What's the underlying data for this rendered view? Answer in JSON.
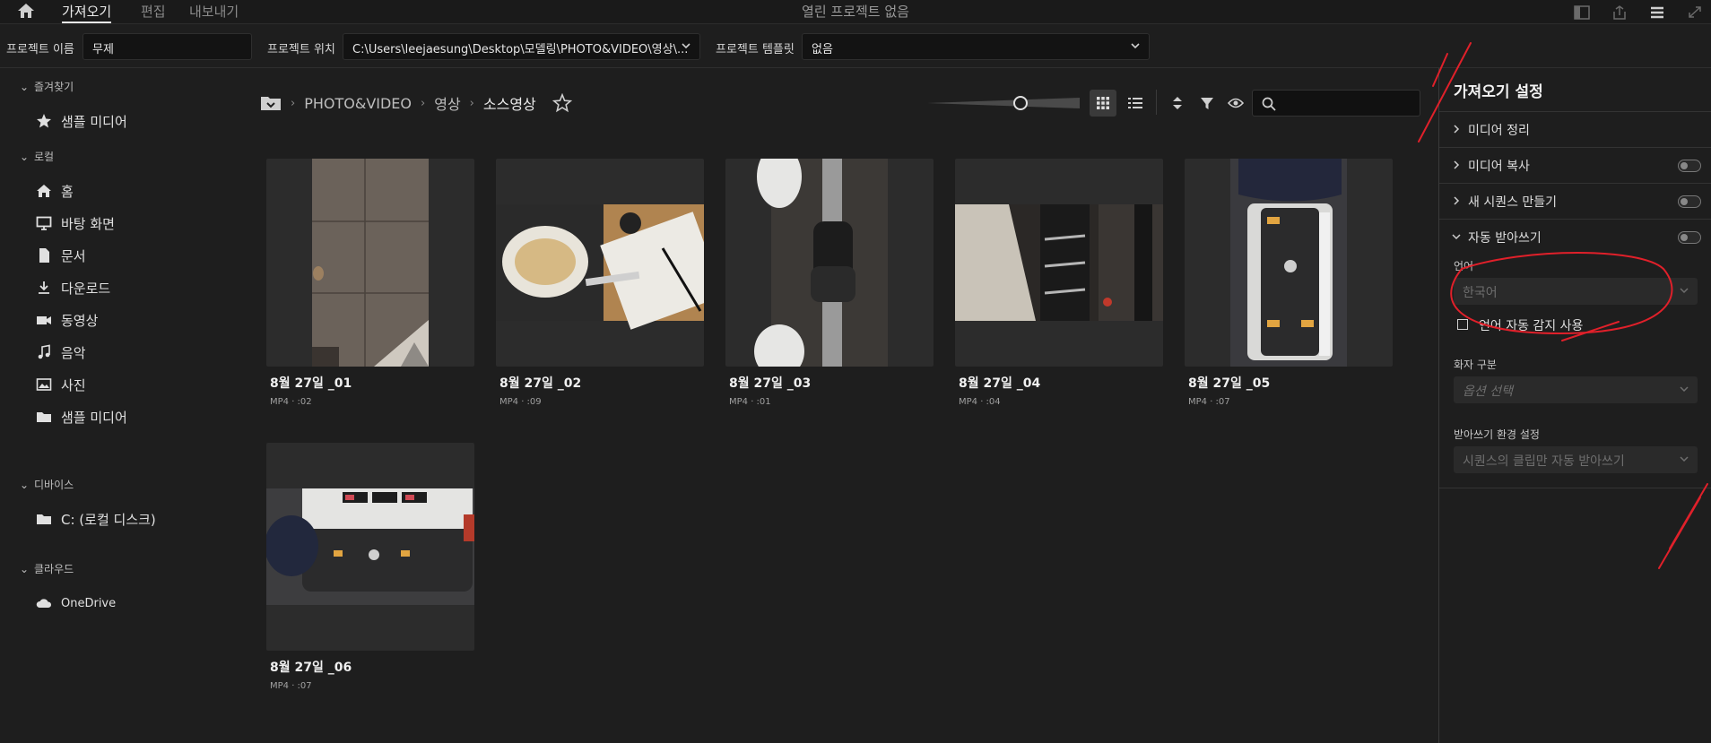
{
  "topbar": {
    "tabs": [
      "가져오기",
      "편집",
      "내보내기"
    ],
    "center_title": "열린 프로젝트 없음"
  },
  "project": {
    "name_label": "프로젝트 이름",
    "name_value": "무제",
    "location_label": "프로젝트 위치",
    "location_value": "C:\\Users\\leejaesung\\Desktop\\모델링\\PHOTO&VIDEO\\영상\\...",
    "template_label": "프로젝트 템플릿",
    "template_value": "없음"
  },
  "sidebar": {
    "favorites_header": "즐겨찾기",
    "favorites": [
      {
        "label": "샘플 미디어",
        "icon": "star-icon"
      }
    ],
    "local_header": "로컬",
    "local": [
      {
        "label": "홈",
        "icon": "home-icon"
      },
      {
        "label": "바탕 화면",
        "icon": "monitor-icon"
      },
      {
        "label": "문서",
        "icon": "document-icon"
      },
      {
        "label": "다운로드",
        "icon": "download-icon"
      },
      {
        "label": "동영상",
        "icon": "video-icon"
      },
      {
        "label": "음악",
        "icon": "music-icon"
      },
      {
        "label": "사진",
        "icon": "image-icon"
      },
      {
        "label": "샘플 미디어",
        "icon": "folder-icon"
      }
    ],
    "devices_header": "디바이스",
    "devices": [
      {
        "label": "C: (로컬 디스크)",
        "icon": "folder-icon"
      }
    ],
    "cloud_header": "클라우드",
    "cloud": [
      {
        "label": "OneDrive",
        "icon": "cloud-icon"
      }
    ]
  },
  "breadcrumb": [
    "PHOTO&VIDEO",
    "영상",
    "소스영상"
  ],
  "media": [
    {
      "name": "8월 27일 _01",
      "meta": "MP4 · :02"
    },
    {
      "name": "8월 27일 _02",
      "meta": "MP4 · :09"
    },
    {
      "name": "8월 27일 _03",
      "meta": "MP4 · :01"
    },
    {
      "name": "8월 27일 _04",
      "meta": "MP4 · :04"
    },
    {
      "name": "8월 27일 _05",
      "meta": "MP4 · :07"
    },
    {
      "name": "8월 27일 _06",
      "meta": "MP4 · :07"
    }
  ],
  "panel": {
    "title": "가져오기 설정",
    "sections": [
      "미디어 정리",
      "미디어 복사",
      "새 시퀀스 만들기",
      "자동 받아쓰기"
    ],
    "language_label": "언어",
    "language_value": "한국어",
    "auto_detect_label": "언어 자동 감지 사용",
    "speaker_label": "화자 구분",
    "speaker_value": "옵션 선택",
    "transcribe_pref_label": "받아쓰기 환경 설정",
    "transcribe_pref_value": "시퀀스의 클립만 자동 받아쓰기"
  },
  "colors": {
    "background": "#1e1e1e",
    "annotation": "#e0202a",
    "panel_border": "#3a3a3a"
  }
}
